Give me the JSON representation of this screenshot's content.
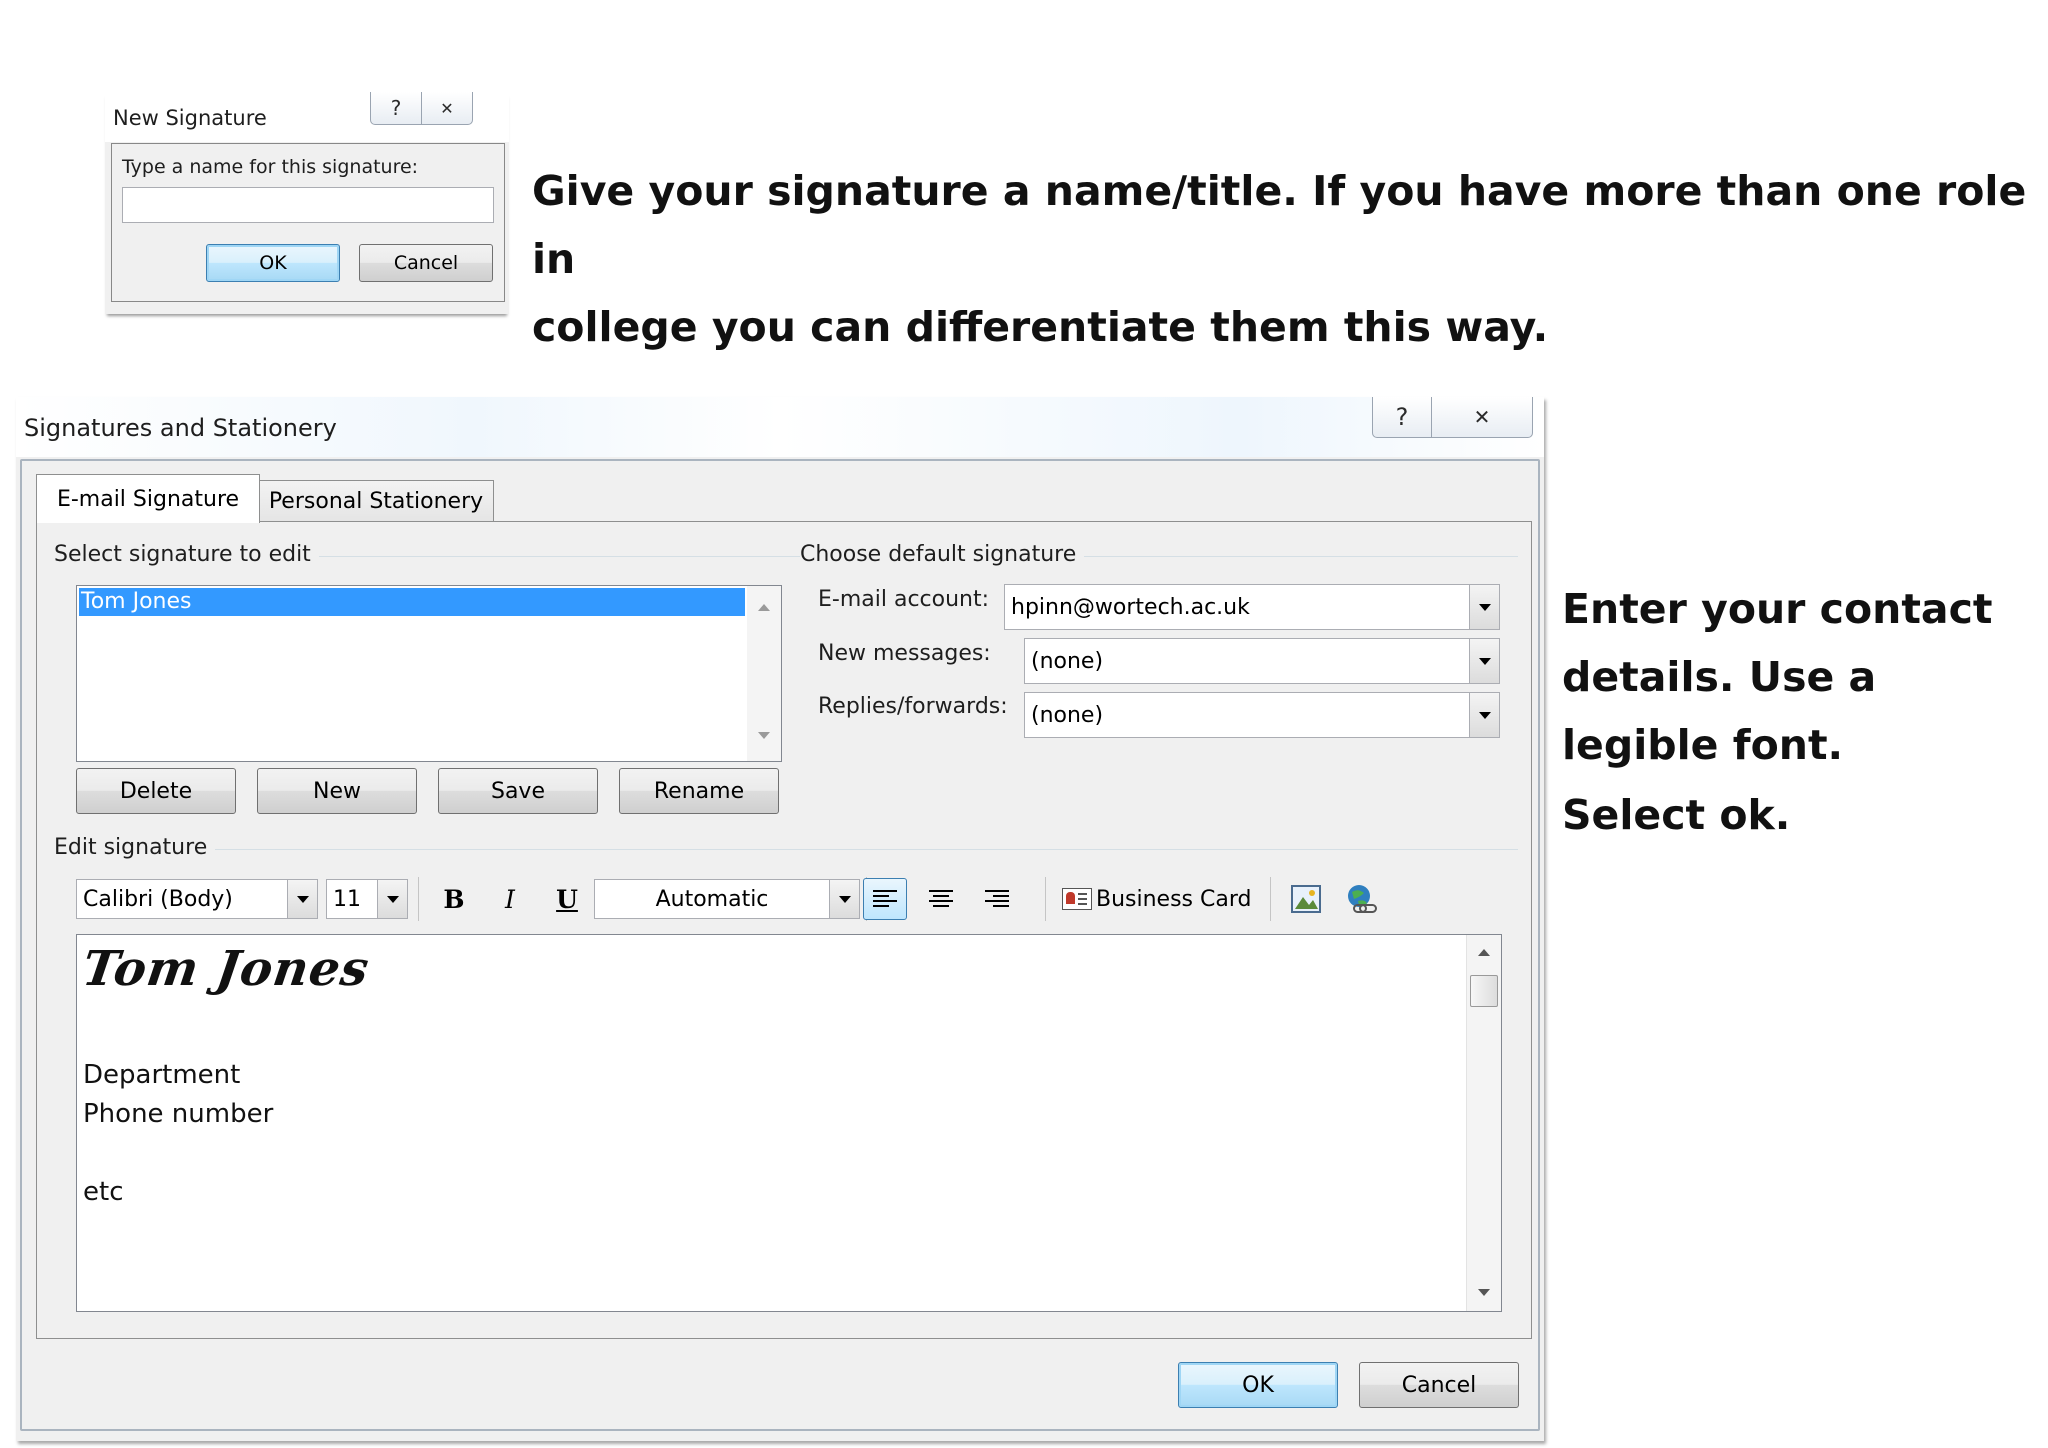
{
  "new_signature_dialog": {
    "title": "New Signature",
    "help_glyph": "?",
    "close_glyph": "✕",
    "prompt": "Type a name for this signature:",
    "input_value": "",
    "ok_label": "OK",
    "cancel_label": "Cancel"
  },
  "instruction_1": {
    "line1": "Give your signature a name/title. If you have more than one role in",
    "line2": "college you can differentiate them this way."
  },
  "instruction_2": {
    "line1": "Enter your contact",
    "line2": "details. Use a",
    "line3": "legible font.",
    "line4": "Select ok."
  },
  "sig_dialog": {
    "title": "Signatures and Stationery",
    "help_glyph": "?",
    "close_glyph": "✕",
    "tabs": [
      {
        "label": "E-mail Signature",
        "active": true
      },
      {
        "label": "Personal Stationery",
        "active": false
      }
    ],
    "select_group_label": "Select signature to edit",
    "signature_list": [
      "Tom Jones"
    ],
    "list_buttons": [
      "Delete",
      "New",
      "Save",
      "Rename"
    ],
    "default_group_label": "Choose default signature",
    "email_account_label": "E-mail account:",
    "email_account_value": "hpinn@wortech.ac.uk",
    "new_messages_label": "New messages:",
    "new_messages_value": "(none)",
    "replies_label": "Replies/forwards:",
    "replies_value": "(none)",
    "edit_group_label": "Edit signature",
    "toolbar": {
      "font": "Calibri (Body)",
      "size": "11",
      "bold": "B",
      "italic": "I",
      "underline": "U",
      "color": "Automatic",
      "business_card": "Business Card"
    },
    "editor": {
      "signature_script": "Tom Jones",
      "line1": "Department",
      "line2": "Phone number",
      "line3": "etc"
    },
    "ok_label": "OK",
    "cancel_label": "Cancel",
    "accent_color": "#3399ff"
  }
}
